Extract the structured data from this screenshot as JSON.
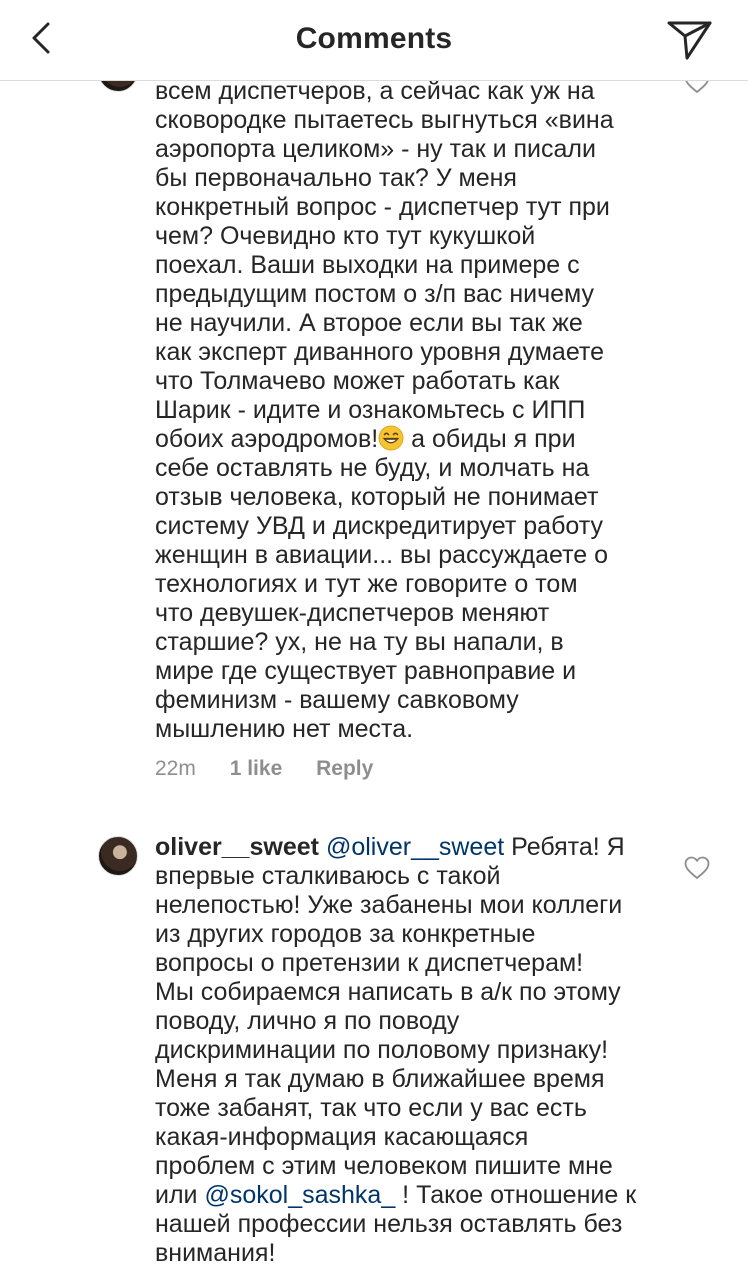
{
  "header": {
    "title": "Comments",
    "back_icon": "chevron-left-icon",
    "share_icon": "paper-plane-icon"
  },
  "comment1": {
    "lines": [
      "всем диспетчеров, а сейчас как уж на",
      "сковородке пытаетесь выгнуться «вина",
      "аэропорта целиком» - ну так и писали",
      "бы первоначально так? У меня",
      "конкретный вопрос - диспетчер тут при",
      "чем? Очевидно кто тут кукушкой",
      "поехал. Ваши выходки на примере с",
      "предыдущим постом о з/п вас ничему",
      "не научили. А второе если вы так же",
      "как эксперт диванного уровня думаете",
      "что Толмачево может работать как",
      "Шарик - идите и ознакомьтесь с ИПП"
    ],
    "emoji_line_before": "обоих аэродромов!",
    "emoji": "grinning-face-icon",
    "emoji_line_after": " а обиды я при",
    "lines_after": [
      "себе оставлять не буду, и молчать на",
      "отзыв человека, который не понимает",
      "систему УВД и дискредитирует работу",
      "женщин в авиации... вы рассуждаете о",
      "технологиях и тут же говорите о том",
      "что девушек-диспетчеров меняют",
      "старшие? ух, не на ту вы напали, в",
      "мире где существует равноправие и",
      "феминизм - вашему савковому",
      "мышлению нет места."
    ],
    "time": "22m",
    "likes": "1 like",
    "reply": "Reply"
  },
  "comment2": {
    "username": "oliver__sweet",
    "mention": "@oliver__sweet",
    "first_line_text": " Ребята! Я",
    "lines": [
      "впервые сталкиваюсь с такой",
      "нелепостью! Уже забанены мои коллеги",
      "из других городов за конкретные",
      "вопросы о претензии к диспетчерам!",
      "Мы собираемся написать в а/к по этому",
      "поводу, лично я по поводу",
      "дискриминации по половому признаку!",
      "Меня я так думаю в ближайшее время",
      "тоже забанят, так что если у вас есть",
      "какая-информация касающаяся",
      "проблем с этим человеком пишите мне"
    ],
    "line_pre_mention": "или ",
    "mention2": "@sokol_sashka_",
    "line_post_mention": " ! Такое отношение к",
    "lines_end": [
      "нашей профессии нельзя оставлять без",
      "внимания!"
    ]
  }
}
